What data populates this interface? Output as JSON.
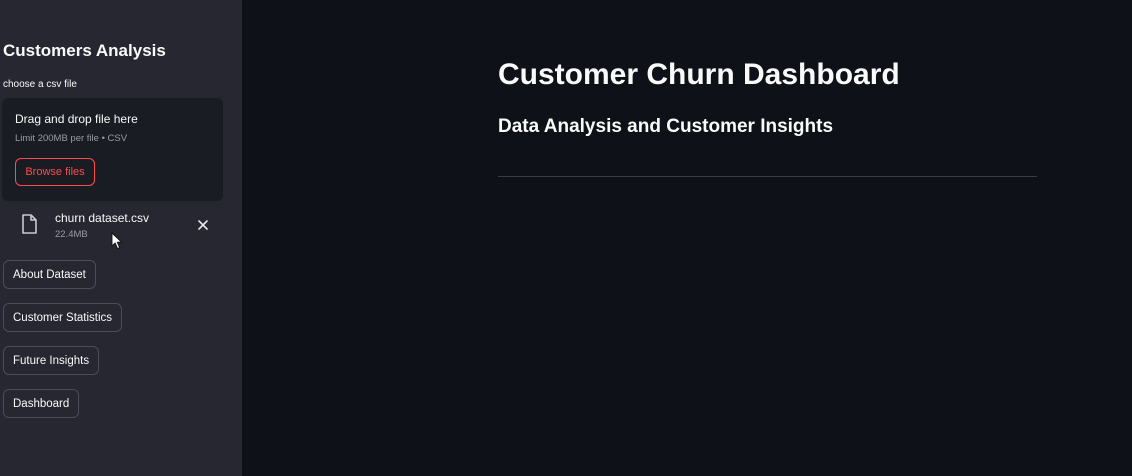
{
  "sidebar": {
    "title": "Customers Analysis",
    "uploader": {
      "label": "choose a csv file",
      "drop_text": "Drag and drop file here",
      "limit_text": "Limit 200MB per file • CSV",
      "browse_label": "Browse files"
    },
    "file": {
      "name": "churn dataset.csv",
      "size": "22.4MB"
    },
    "nav_buttons": [
      {
        "label": "About Dataset"
      },
      {
        "label": "Customer Statistics"
      },
      {
        "label": "Future Insights"
      },
      {
        "label": "Dashboard"
      }
    ]
  },
  "main": {
    "title": "Customer Churn Dashboard",
    "subtitle": "Data Analysis and Customer Insights"
  },
  "colors": {
    "sidebar_bg": "#262730",
    "main_bg": "#0e1117",
    "accent": "#ff4b4b"
  }
}
